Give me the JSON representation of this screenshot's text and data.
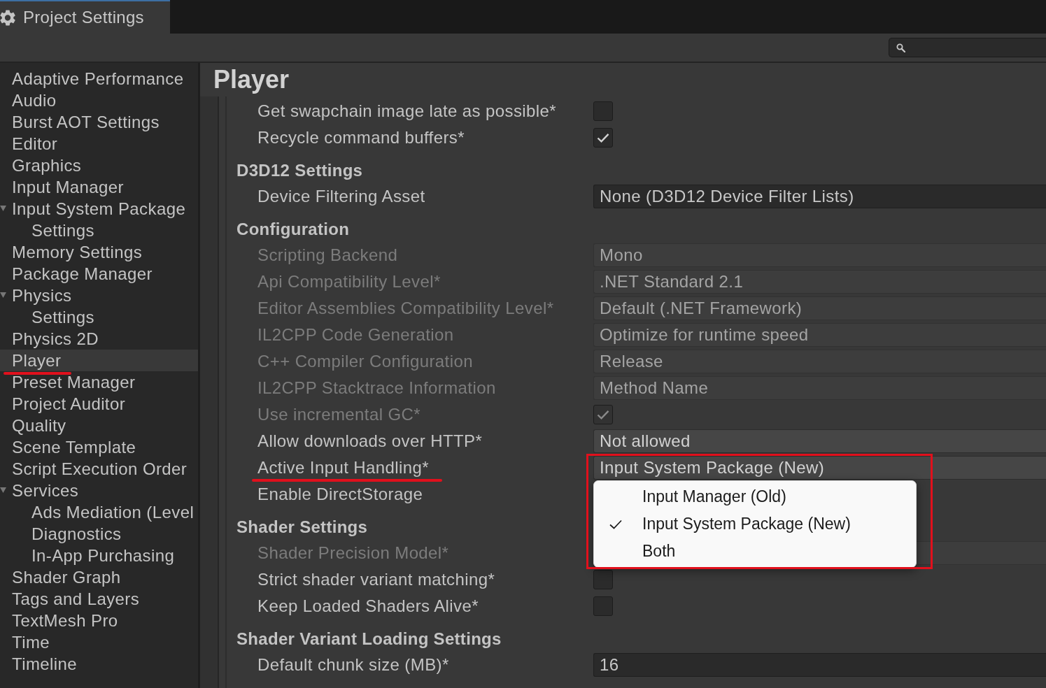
{
  "tab": {
    "title": "Project Settings",
    "selected": true
  },
  "sidebar": {
    "items": [
      {
        "label": "Adaptive Performance",
        "selected": false,
        "marked": false
      },
      {
        "label": "Audio",
        "selected": false,
        "marked": false
      },
      {
        "label": "Burst AOT Settings",
        "selected": false,
        "marked": false
      },
      {
        "label": "Editor",
        "selected": false,
        "marked": false
      },
      {
        "label": "Graphics",
        "selected": false,
        "marked": false
      },
      {
        "label": "Input Manager",
        "selected": false,
        "marked": false
      },
      {
        "label": "Input System Package",
        "selected": false,
        "marked": false,
        "expanded": true,
        "children": [
          {
            "label": "Settings",
            "selected": false,
            "marked": false
          }
        ]
      },
      {
        "label": "Memory Settings",
        "selected": false,
        "marked": false
      },
      {
        "label": "Package Manager",
        "selected": false,
        "marked": false
      },
      {
        "label": "Physics",
        "selected": false,
        "marked": false,
        "expanded": true,
        "children": [
          {
            "label": "Settings",
            "selected": false,
            "marked": false
          }
        ]
      },
      {
        "label": "Physics 2D",
        "selected": false,
        "marked": false
      },
      {
        "label": "Player",
        "selected": true,
        "marked": true
      },
      {
        "label": "Preset Manager",
        "selected": false,
        "marked": false
      },
      {
        "label": "Project Auditor",
        "selected": false,
        "marked": false
      },
      {
        "label": "Quality",
        "selected": false,
        "marked": false
      },
      {
        "label": "Scene Template",
        "selected": false,
        "marked": false
      },
      {
        "label": "Script Execution Order",
        "selected": false,
        "marked": false
      },
      {
        "label": "Services",
        "selected": false,
        "marked": false,
        "expanded": true,
        "children": [
          {
            "label": "Ads Mediation (Level",
            "selected": false,
            "marked": false
          },
          {
            "label": "Diagnostics",
            "selected": false,
            "marked": false
          },
          {
            "label": "In-App Purchasing",
            "selected": false,
            "marked": false
          }
        ]
      },
      {
        "label": "Shader Graph",
        "selected": false,
        "marked": false
      },
      {
        "label": "Tags and Layers",
        "selected": false,
        "marked": false
      },
      {
        "label": "TextMesh Pro",
        "selected": false,
        "marked": false
      },
      {
        "label": "Time",
        "selected": false,
        "marked": false
      },
      {
        "label": "Timeline",
        "selected": false,
        "marked": false
      }
    ]
  },
  "page": {
    "title": "Player"
  },
  "settings": [
    {
      "kind": "checkbox",
      "label": "Get swapchain image late as possible*",
      "disabled": false,
      "checked": false,
      "marked": false
    },
    {
      "kind": "checkbox",
      "label": "Recycle command buffers*",
      "disabled": false,
      "checked": true,
      "marked": false
    },
    {
      "kind": "header",
      "label": "D3D12 Settings"
    },
    {
      "kind": "object",
      "label": "Device Filtering Asset",
      "disabled": false,
      "value": "None (D3D12 Device Filter Lists)",
      "marked": false
    },
    {
      "kind": "header",
      "label": "Configuration"
    },
    {
      "kind": "dropdown",
      "label": "Scripting Backend",
      "disabled": true,
      "value": "Mono",
      "marked": false
    },
    {
      "kind": "dropdown",
      "label": "Api Compatibility Level*",
      "disabled": true,
      "value": ".NET Standard 2.1",
      "marked": false
    },
    {
      "kind": "dropdown",
      "label": "Editor Assemblies Compatibility Level*",
      "disabled": true,
      "value": "Default (.NET Framework)",
      "marked": false
    },
    {
      "kind": "dropdown",
      "label": "IL2CPP Code Generation",
      "disabled": true,
      "value": "Optimize for runtime speed",
      "marked": false
    },
    {
      "kind": "dropdown",
      "label": "C++ Compiler Configuration",
      "disabled": true,
      "value": "Release",
      "marked": false
    },
    {
      "kind": "dropdown",
      "label": "IL2CPP Stacktrace Information",
      "disabled": true,
      "value": "Method Name",
      "marked": false
    },
    {
      "kind": "checkbox",
      "label": "Use incremental GC*",
      "disabled": true,
      "checked": true,
      "marked": false
    },
    {
      "kind": "dropdown",
      "label": "Allow downloads over HTTP*",
      "disabled": false,
      "value": "Not allowed",
      "marked": false
    },
    {
      "kind": "dropdown",
      "label": "Active Input Handling*",
      "disabled": false,
      "value": "Input System Package (New)",
      "marked": true,
      "popup": {
        "highlighted": true,
        "options": [
          {
            "label": "Input Manager (Old)",
            "selected": false
          },
          {
            "label": "Input System Package (New)",
            "selected": true
          },
          {
            "label": "Both",
            "selected": false
          }
        ]
      }
    },
    {
      "kind": "plain",
      "label": "Enable DirectStorage",
      "disabled": false,
      "marked": false
    },
    {
      "kind": "header",
      "label": "Shader Settings"
    },
    {
      "kind": "dropdown",
      "label": "Shader Precision Model*",
      "disabled": true,
      "marked": false
    },
    {
      "kind": "checkbox",
      "label": "Strict shader variant matching*",
      "disabled": false,
      "checked": false,
      "marked": false
    },
    {
      "kind": "checkbox",
      "label": "Keep Loaded Shaders Alive*",
      "disabled": false,
      "checked": false,
      "marked": false
    },
    {
      "kind": "header",
      "label": "Shader Variant Loading Settings"
    },
    {
      "kind": "number",
      "label": "Default chunk size (MB)*",
      "disabled": false,
      "value": "16",
      "marked": false
    }
  ]
}
